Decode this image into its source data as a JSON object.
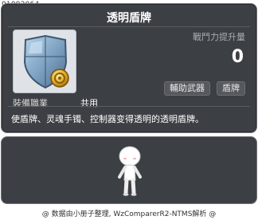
{
  "item_id": "01092064",
  "item": {
    "name": "透明盾牌",
    "stat_label": "戰鬥力提升量",
    "stat_value": "0",
    "tags": [
      "輔助武器",
      "盾牌"
    ],
    "job_label": "裝備職業",
    "job_value": "共用",
    "description": "使盾牌、灵魂手镯、控制器变得透明的透明盾牌。",
    "icon": "shield-with-gold-coin-icon"
  },
  "preview": {
    "icon": "character-avatar"
  },
  "footer": "@ 数据由小册子整理, WzComparerR2-NTMS解析 @",
  "colors": {
    "panel_bg": "#3c3f43",
    "panel_border": "#6f7276",
    "text_primary": "#ffffff",
    "text_muted": "#a9adb3"
  }
}
